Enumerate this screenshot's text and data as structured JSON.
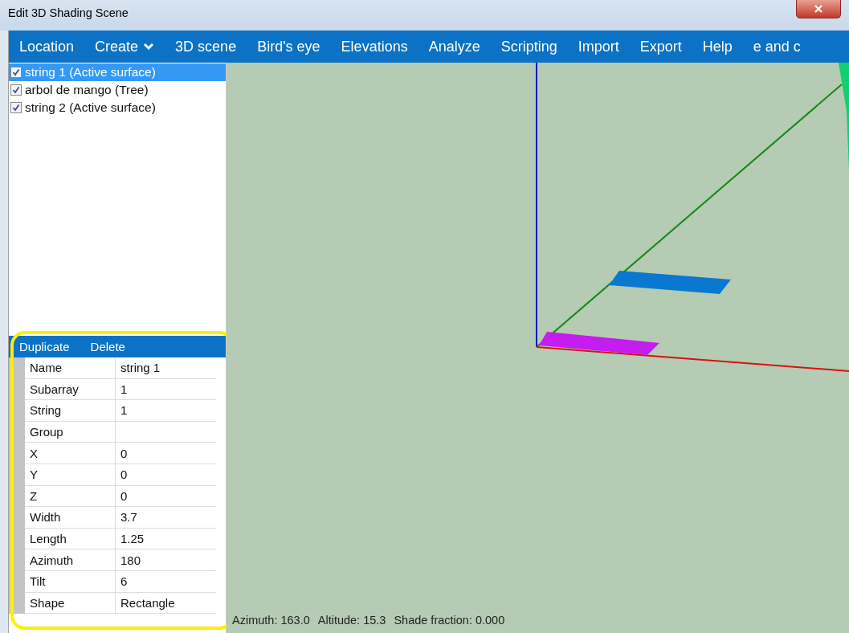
{
  "window": {
    "title": "Edit 3D Shading Scene"
  },
  "menu": [
    {
      "label": "Location",
      "kind": "item"
    },
    {
      "label": "Create",
      "kind": "dropdown"
    },
    {
      "label": "3D scene",
      "kind": "item"
    },
    {
      "label": "Bird's eye",
      "kind": "item"
    },
    {
      "label": "Elevations",
      "kind": "item"
    },
    {
      "label": "Analyze",
      "kind": "item"
    },
    {
      "label": "Scripting",
      "kind": "item"
    },
    {
      "label": "Import",
      "kind": "item"
    },
    {
      "label": "Export",
      "kind": "item"
    },
    {
      "label": "Help",
      "kind": "item"
    },
    {
      "label": "e and c",
      "kind": "item"
    }
  ],
  "objects": [
    {
      "label": "string 1 (Active surface)",
      "checked": true,
      "selected": true
    },
    {
      "label": "arbol de mango (Tree)",
      "checked": true,
      "selected": false
    },
    {
      "label": "string 2 (Active surface)",
      "checked": true,
      "selected": false
    }
  ],
  "properties": {
    "actions": [
      "Duplicate",
      "Delete"
    ],
    "rows": [
      {
        "name": "Name",
        "value": "string 1"
      },
      {
        "name": "Subarray",
        "value": "1"
      },
      {
        "name": "String",
        "value": "1"
      },
      {
        "name": "Group"
      },
      {
        "name": "X",
        "value": "0"
      },
      {
        "name": "Y",
        "value": "0"
      },
      {
        "name": "Z",
        "value": "0"
      },
      {
        "name": "Width",
        "value": "3.7"
      },
      {
        "name": "Length",
        "value": "1.25"
      },
      {
        "name": "Azimuth",
        "value": "180"
      },
      {
        "name": "Tilt",
        "value": "6"
      },
      {
        "name": "Shape",
        "value": "Rectangle"
      }
    ]
  },
  "scene": {
    "surfaces": [
      {
        "color": "#c51cf0"
      },
      {
        "color": "#0a78d0"
      }
    ]
  },
  "status_bar": [
    "Azimuth: 163.0",
    "Altitude: 15.3",
    "Shade fraction: 0.000"
  ]
}
